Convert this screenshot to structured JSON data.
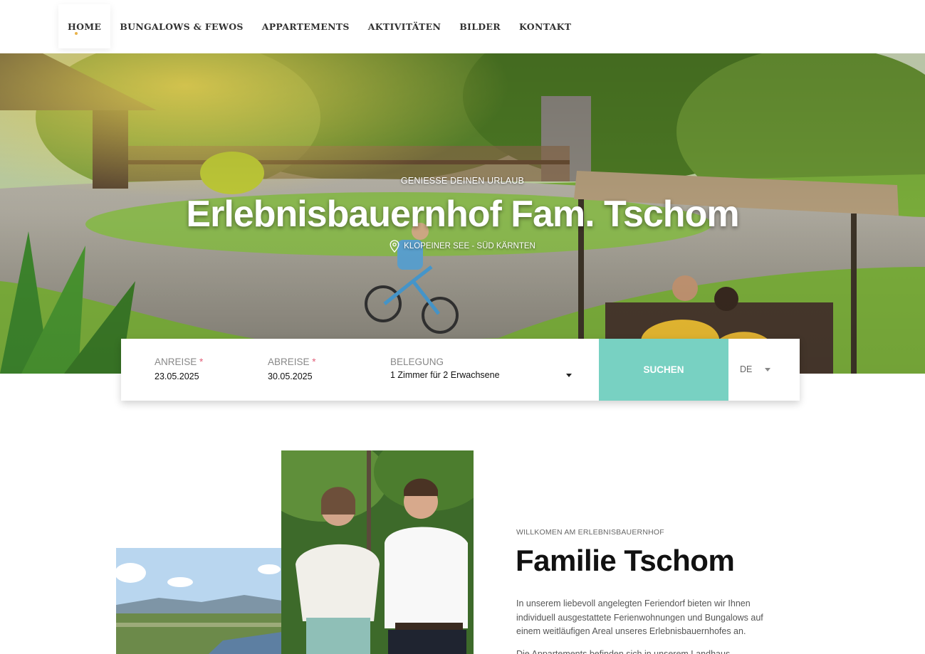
{
  "nav": {
    "items": [
      {
        "label": "HOME",
        "active": true
      },
      {
        "label": "BUNGALOWS & FEWOS",
        "active": false
      },
      {
        "label": "APPARTEMENTS",
        "active": false
      },
      {
        "label": "AKTIVITÄTEN",
        "active": false
      },
      {
        "label": "BILDER",
        "active": false
      },
      {
        "label": "KONTAKT",
        "active": false
      }
    ]
  },
  "hero": {
    "kicker": "GENIESSE DEINEN URLAUB",
    "title": "Erlebnisbauernhof Fam. Tschom",
    "location": "KLOPEINER SEE - SÜD KÄRNTEN",
    "location_icon": "map-pin-icon"
  },
  "booking": {
    "arrival_label": "ANREISE",
    "arrival_value": "23.05.2025",
    "departure_label": "ABREISE",
    "departure_value": "30.05.2025",
    "required_mark": "*",
    "occupancy_label": "BELEGUNG",
    "occupancy_value": "1 Zimmer für 2 Erwachsene",
    "search_label": "SUCHEN",
    "language_value": "DE"
  },
  "intro": {
    "kicker": "WILLKOMEN AM ERLEBNISBAUERNHOF",
    "title": "Familie Tschom",
    "paragraph": "In unserem liebevoll angelegten Feriendorf bieten wir Ihnen individuell ausgestattete Ferienwohnungen und Bungalows auf einem weitläufigen Areal unseres Erlebnisbauernhofes an.",
    "paragraph_2": "Die Appartements befinden sich in unserem Landhaus"
  },
  "colors": {
    "accent": "#78d1c2",
    "required": "#e2607a"
  }
}
